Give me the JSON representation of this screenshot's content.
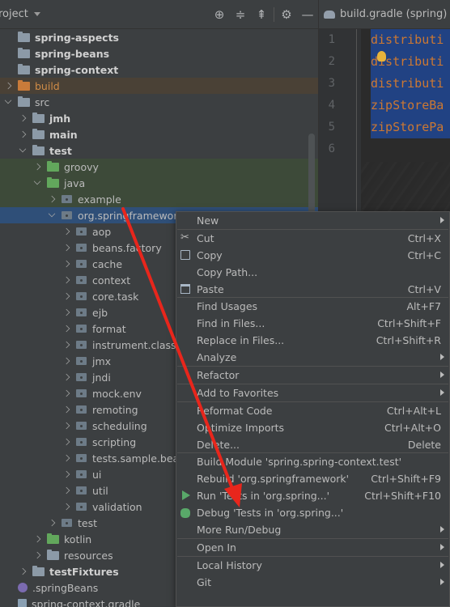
{
  "project_header": {
    "title": "roject",
    "tool_icons": [
      "crosshair-icon",
      "expand-all-icon",
      "collapse-all-icon",
      "gear-icon",
      "minimize-icon"
    ]
  },
  "tree": [
    {
      "label": "spring-aspects",
      "depth": 0,
      "arrow": "none",
      "icon": "module",
      "style": "bold"
    },
    {
      "label": "spring-beans",
      "depth": 0,
      "arrow": "none",
      "icon": "module",
      "style": "bold"
    },
    {
      "label": "spring-context",
      "depth": 0,
      "arrow": "none",
      "icon": "module",
      "style": "bold"
    },
    {
      "label": "build",
      "depth": 0,
      "arrow": "right",
      "icon": "folder-orange",
      "style": "orange",
      "bg": "brown"
    },
    {
      "label": "src",
      "depth": 0,
      "arrow": "down",
      "icon": "folder",
      "style": "normal"
    },
    {
      "label": "jmh",
      "depth": 1,
      "arrow": "right",
      "icon": "folder",
      "style": "bold"
    },
    {
      "label": "main",
      "depth": 1,
      "arrow": "right",
      "icon": "folder",
      "style": "bold"
    },
    {
      "label": "test",
      "depth": 1,
      "arrow": "down",
      "icon": "folder",
      "style": "bold"
    },
    {
      "label": "groovy",
      "depth": 2,
      "arrow": "right",
      "icon": "folder-green",
      "style": "normal",
      "bg": "green"
    },
    {
      "label": "java",
      "depth": 2,
      "arrow": "down",
      "icon": "folder-green",
      "style": "normal",
      "bg": "green"
    },
    {
      "label": "example",
      "depth": 3,
      "arrow": "right",
      "icon": "package",
      "style": "normal",
      "bg": "green"
    },
    {
      "label": "org.springframework",
      "depth": 3,
      "arrow": "down",
      "icon": "package",
      "style": "normal",
      "bg": "sel"
    },
    {
      "label": "aop",
      "depth": 4,
      "arrow": "right",
      "icon": "package",
      "style": "normal"
    },
    {
      "label": "beans.factory",
      "depth": 4,
      "arrow": "right",
      "icon": "package",
      "style": "normal"
    },
    {
      "label": "cache",
      "depth": 4,
      "arrow": "right",
      "icon": "package",
      "style": "normal"
    },
    {
      "label": "context",
      "depth": 4,
      "arrow": "right",
      "icon": "package",
      "style": "normal"
    },
    {
      "label": "core.task",
      "depth": 4,
      "arrow": "right",
      "icon": "package",
      "style": "normal"
    },
    {
      "label": "ejb",
      "depth": 4,
      "arrow": "right",
      "icon": "package",
      "style": "normal"
    },
    {
      "label": "format",
      "depth": 4,
      "arrow": "right",
      "icon": "package",
      "style": "normal"
    },
    {
      "label": "instrument.classlo",
      "depth": 4,
      "arrow": "right",
      "icon": "package",
      "style": "normal"
    },
    {
      "label": "jmx",
      "depth": 4,
      "arrow": "right",
      "icon": "package",
      "style": "normal"
    },
    {
      "label": "jndi",
      "depth": 4,
      "arrow": "right",
      "icon": "package",
      "style": "normal"
    },
    {
      "label": "mock.env",
      "depth": 4,
      "arrow": "right",
      "icon": "package",
      "style": "normal"
    },
    {
      "label": "remoting",
      "depth": 4,
      "arrow": "right",
      "icon": "package",
      "style": "normal"
    },
    {
      "label": "scheduling",
      "depth": 4,
      "arrow": "right",
      "icon": "package",
      "style": "normal"
    },
    {
      "label": "scripting",
      "depth": 4,
      "arrow": "right",
      "icon": "package",
      "style": "normal"
    },
    {
      "label": "tests.sample.bean",
      "depth": 4,
      "arrow": "right",
      "icon": "package",
      "style": "normal"
    },
    {
      "label": "ui",
      "depth": 4,
      "arrow": "right",
      "icon": "package",
      "style": "normal"
    },
    {
      "label": "util",
      "depth": 4,
      "arrow": "right",
      "icon": "package",
      "style": "normal"
    },
    {
      "label": "validation",
      "depth": 4,
      "arrow": "right",
      "icon": "package",
      "style": "normal"
    },
    {
      "label": "test",
      "depth": 3,
      "arrow": "right",
      "icon": "package",
      "style": "normal"
    },
    {
      "label": "kotlin",
      "depth": 2,
      "arrow": "right",
      "icon": "folder-green",
      "style": "normal"
    },
    {
      "label": "resources",
      "depth": 2,
      "arrow": "right",
      "icon": "folder-res",
      "style": "normal"
    },
    {
      "label": "testFixtures",
      "depth": 1,
      "arrow": "right",
      "icon": "folder",
      "style": "bold"
    },
    {
      "label": ".springBeans",
      "depth": 0,
      "arrow": "none",
      "icon": "file-spring",
      "style": "normal"
    },
    {
      "label": "spring-context.gradle",
      "depth": 0,
      "arrow": "none",
      "icon": "file",
      "style": "normal"
    }
  ],
  "editor": {
    "tab_title": "build.gradle (spring)",
    "line_numbers": [
      "1",
      "2",
      "3",
      "4",
      "5",
      "6"
    ],
    "lines": [
      "distributi",
      "distributi",
      "distributi",
      "zipStoreBa",
      "zipStorePa",
      ""
    ]
  },
  "context_menu": [
    {
      "type": "item",
      "label": "New",
      "shortcut": "",
      "submenu": true
    },
    {
      "type": "sep"
    },
    {
      "type": "item",
      "label": "Cut",
      "shortcut": "Ctrl+X",
      "icon": "cut"
    },
    {
      "type": "item",
      "label": "Copy",
      "shortcut": "Ctrl+C",
      "icon": "copy"
    },
    {
      "type": "item",
      "label": "Copy Path...",
      "shortcut": ""
    },
    {
      "type": "item",
      "label": "Paste",
      "shortcut": "Ctrl+V",
      "icon": "paste"
    },
    {
      "type": "sep"
    },
    {
      "type": "item",
      "label": "Find Usages",
      "shortcut": "Alt+F7"
    },
    {
      "type": "item",
      "label": "Find in Files...",
      "shortcut": "Ctrl+Shift+F"
    },
    {
      "type": "item",
      "label": "Replace in Files...",
      "shortcut": "Ctrl+Shift+R"
    },
    {
      "type": "item",
      "label": "Analyze",
      "shortcut": "",
      "submenu": true
    },
    {
      "type": "sep"
    },
    {
      "type": "item",
      "label": "Refactor",
      "shortcut": "",
      "submenu": true
    },
    {
      "type": "sep"
    },
    {
      "type": "item",
      "label": "Add to Favorites",
      "shortcut": "",
      "submenu": true
    },
    {
      "type": "sep"
    },
    {
      "type": "item",
      "label": "Reformat Code",
      "shortcut": "Ctrl+Alt+L"
    },
    {
      "type": "item",
      "label": "Optimize Imports",
      "shortcut": "Ctrl+Alt+O"
    },
    {
      "type": "item",
      "label": "Delete...",
      "shortcut": "Delete"
    },
    {
      "type": "sep"
    },
    {
      "type": "item",
      "label": "Build Module 'spring.spring-context.test'",
      "shortcut": ""
    },
    {
      "type": "item",
      "label": "Rebuild 'org.springframework'",
      "shortcut": "Ctrl+Shift+F9"
    },
    {
      "type": "item",
      "label": "Run 'Tests in 'org.spring...'",
      "shortcut": "Ctrl+Shift+F10",
      "icon": "run"
    },
    {
      "type": "item",
      "label": "Debug 'Tests in 'org.spring...'",
      "shortcut": "",
      "icon": "debug"
    },
    {
      "type": "item",
      "label": "More Run/Debug",
      "shortcut": "",
      "submenu": true
    },
    {
      "type": "sep"
    },
    {
      "type": "item",
      "label": "Open In",
      "shortcut": "",
      "submenu": true
    },
    {
      "type": "sep"
    },
    {
      "type": "item",
      "label": "Local History",
      "shortcut": "",
      "submenu": true
    },
    {
      "type": "item",
      "label": "Git",
      "shortcut": "",
      "submenu": true
    }
  ],
  "colors": {
    "annotation_arrow": "#e8261c",
    "selection": "#2f4f78",
    "test_root_bg": "#3d4a39",
    "excluded_bg": "#4a4136"
  }
}
